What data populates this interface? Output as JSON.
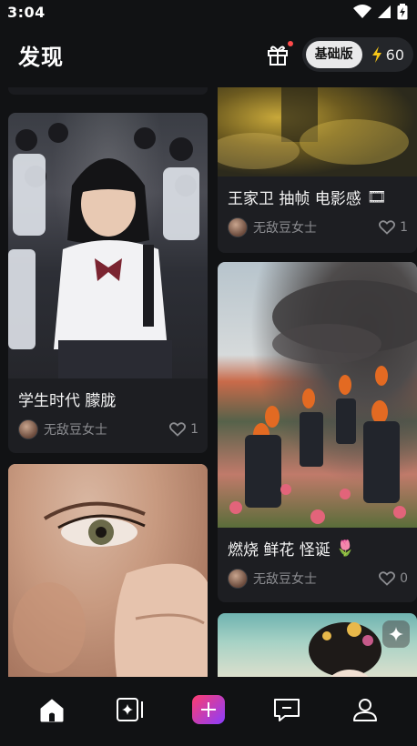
{
  "status_bar": {
    "time": "3:04"
  },
  "header": {
    "title": "发现",
    "plan_label": "基础版",
    "credits": "60"
  },
  "feed": {
    "cards": [
      {
        "title": "王家卫 抽帧 电影感",
        "emoji": "🎞",
        "author": "无敌豆女士",
        "likes": "1"
      },
      {
        "title": "学生时代 朦胧",
        "emoji": "",
        "author": "无敌豆女士",
        "likes": "1"
      },
      {
        "title": "燃烧 鲜花 怪诞",
        "emoji": "🌷",
        "author": "无敌豆女士",
        "likes": "0"
      }
    ]
  },
  "icons": [
    "wifi-icon",
    "signal-icon",
    "battery-icon",
    "gift-icon",
    "bolt-icon",
    "heart-icon",
    "home-icon",
    "create-icon",
    "plus-icon",
    "message-icon",
    "profile-icon",
    "sparkle-icon"
  ],
  "colors": {
    "background": "#111214",
    "card": "#1d1e22",
    "accent_start": "#ff3d6e",
    "accent_end": "#8a3dff",
    "bolt": "#f5c518"
  }
}
